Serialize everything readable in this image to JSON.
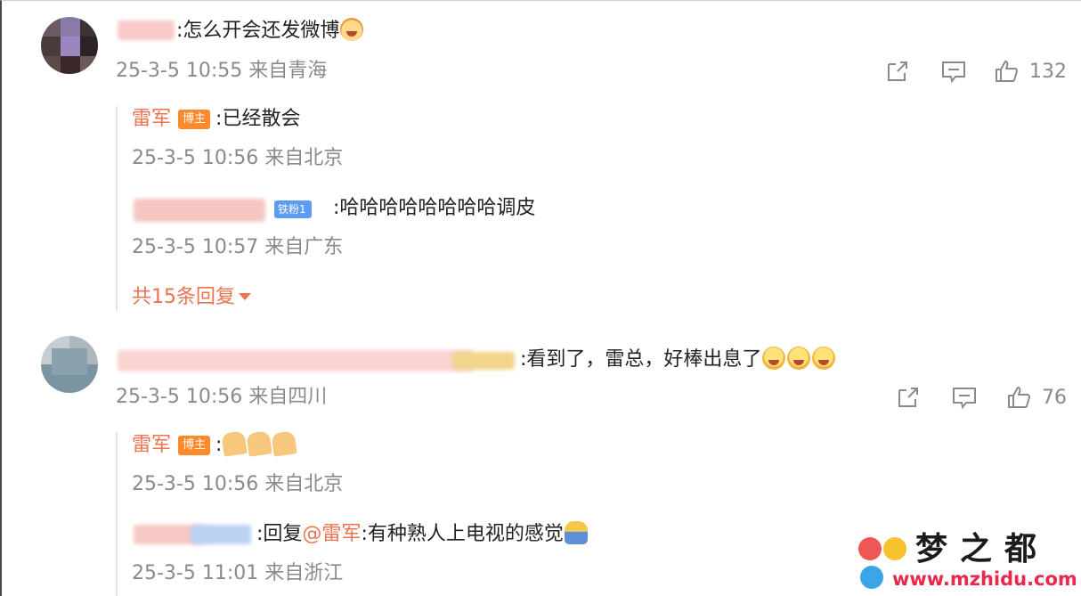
{
  "comments": [
    {
      "text": ":怎么开会还发微博",
      "emoji": "cat-face",
      "time": "25-3-5 10:55 来自青海",
      "actions": {
        "share_icon": "share-icon",
        "comment_icon": "comment-icon",
        "like_icon": "thumb-up-icon",
        "likes": "132"
      },
      "replies": [
        {
          "name": "雷军",
          "badge": "博主",
          "text": ":已经散会",
          "time": "25-3-5 10:56 来自北京"
        },
        {
          "fan_badge": "铁粉1",
          "text": ":哈哈哈哈哈哈哈哈调皮",
          "time": "25-3-5 10:57 来自广东"
        }
      ],
      "more_replies": "共15条回复"
    },
    {
      "text": ":看到了，雷总，好棒出息了",
      "emoji": "crying-face",
      "time": "25-3-5 10:56 来自四川",
      "actions": {
        "share_icon": "share-icon",
        "comment_icon": "comment-icon",
        "like_icon": "thumb-up-icon",
        "likes": "76"
      },
      "replies": [
        {
          "name": "雷军",
          "badge": "博主",
          "text": ":",
          "emoji": "praying-hands",
          "time": "25-3-5 10:56 来自北京"
        },
        {
          "text_prefix": ":回复",
          "mention": "@雷军",
          "text": ":有种熟人上电视的感觉",
          "emoji": "person",
          "time": "25-3-5 11:01 来自浙江"
        }
      ]
    }
  ],
  "watermark": {
    "title": "梦之都",
    "url": "www.mzhidu.com"
  },
  "colors": {
    "accent": "#eb7350",
    "meta": "#8a8a8a",
    "badge": "#ff8a2b",
    "fan_badge": "#5e9bf2"
  }
}
